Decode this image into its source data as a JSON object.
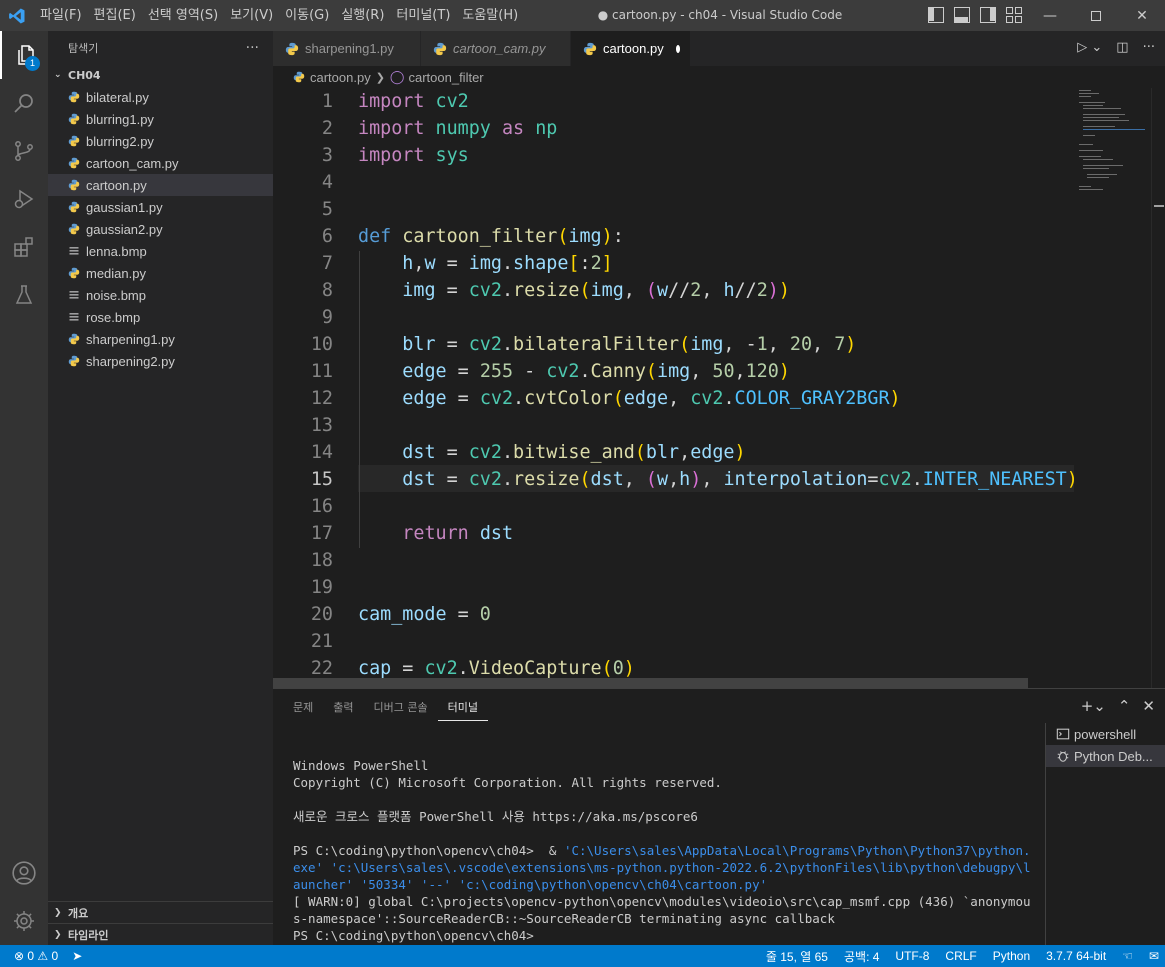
{
  "window": {
    "title": "● cartoon.py - ch04 - Visual Studio Code",
    "menu": [
      "파일(F)",
      "편집(E)",
      "선택 영역(S)",
      "보기(V)",
      "이동(G)",
      "실행(R)",
      "터미널(T)",
      "도움말(H)"
    ]
  },
  "activity": {
    "explorer_badge": "1"
  },
  "sidebar": {
    "header": "탐색기",
    "more": "···",
    "folder": "CH04",
    "files": [
      {
        "name": "bilateral.py",
        "type": "py"
      },
      {
        "name": "blurring1.py",
        "type": "py"
      },
      {
        "name": "blurring2.py",
        "type": "py"
      },
      {
        "name": "cartoon_cam.py",
        "type": "py"
      },
      {
        "name": "cartoon.py",
        "type": "py"
      },
      {
        "name": "gaussian1.py",
        "type": "py"
      },
      {
        "name": "gaussian2.py",
        "type": "py"
      },
      {
        "name": "lenna.bmp",
        "type": "bmp"
      },
      {
        "name": "median.py",
        "type": "py"
      },
      {
        "name": "noise.bmp",
        "type": "bmp"
      },
      {
        "name": "rose.bmp",
        "type": "bmp"
      },
      {
        "name": "sharpening1.py",
        "type": "py"
      },
      {
        "name": "sharpening2.py",
        "type": "py"
      }
    ],
    "outline": "개요",
    "timeline": "타임라인"
  },
  "tabs": [
    {
      "label": "sharpening1.py"
    },
    {
      "label": "cartoon_cam.py"
    },
    {
      "label": "cartoon.py"
    }
  ],
  "breadcrumb": {
    "file": "cartoon.py",
    "symbol": "cartoon_filter"
  },
  "editor": {
    "line_numbers": [
      "1",
      "2",
      "3",
      "4",
      "5",
      "6",
      "7",
      "8",
      "9",
      "10",
      "11",
      "12",
      "13",
      "14",
      "15",
      "16",
      "17",
      "18",
      "19",
      "20",
      "21",
      "22"
    ],
    "code": [
      "import cv2",
      "import numpy as np",
      "import sys",
      "",
      "",
      "def cartoon_filter(img):",
      "    h,w = img.shape[:2]",
      "    img = cv2.resize(img, (w//2, h//2))",
      "",
      "    blr = cv2.bilateralFilter(img, -1, 20, 7)",
      "    edge = 255 - cv2.Canny(img, 50,120)",
      "    edge = cv2.cvtColor(edge, cv2.COLOR_GRAY2BGR)",
      "",
      "    dst = cv2.bitwise_and(blr,edge)",
      "    dst = cv2.resize(dst, (w,h), interpolation=cv2.INTER_NEAREST)",
      "",
      "    return dst",
      "",
      "",
      "cam_mode = 0",
      "",
      "cap = cv2.VideoCapture(0)"
    ]
  },
  "panel": {
    "tabs": [
      "문제",
      "출력",
      "디버그 콘솔",
      "터미널"
    ],
    "terminal_lines": {
      "l1": "Windows PowerShell",
      "l2": "Copyright (C) Microsoft Corporation. All rights reserved.",
      "l3": "새로운 크로스 플랫폼 PowerShell 사용 https://aka.ms/pscore6",
      "prompt1": "PS C:\\coding\\python\\opencv\\ch04>  & ",
      "cmd": "'C:\\Users\\sales\\AppData\\Local\\Programs\\Python\\Python37\\python.exe' 'c:\\Users\\sales\\.vscode\\extensions\\ms-python.python-2022.6.2\\pythonFiles\\lib\\python\\debugpy\\launcher' '50334' '--' 'c:\\coding\\python\\opencv\\ch04\\cartoon.py'",
      "warn": "[ WARN:0] global C:\\projects\\opencv-python\\opencv\\modules\\videoio\\src\\cap_msmf.cpp (436) `anonymous-namespace'::SourceReaderCB::~SourceReaderCB terminating async callback",
      "prompt2": "PS C:\\coding\\python\\opencv\\ch04>"
    },
    "terminals": [
      "powershell",
      "Python Deb..."
    ]
  },
  "statusbar": {
    "errors": "0",
    "warnings": "0",
    "position": "줄 15, 열 65",
    "spaces": "공백: 4",
    "encoding": "UTF-8",
    "eol": "CRLF",
    "language": "Python",
    "interpreter": "3.7.7 64-bit"
  },
  "colors": {
    "accent": "#007acc",
    "titlebar": "#3c3c3c",
    "sidebar": "#252526",
    "editor": "#1e1e1e"
  }
}
